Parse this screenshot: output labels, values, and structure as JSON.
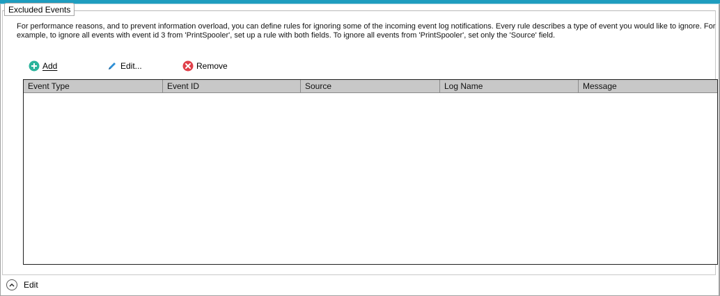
{
  "group": {
    "title": "Excluded Events"
  },
  "description": "For performance reasons, and to prevent information overload, you can define rules for ignoring some of the incoming event log notifications. Every rule describes a type of event you would like to ignore. For example, to ignore all events with event id 3 from 'PrintSpooler', set up a rule with both fields. To ignore all events from 'PrintSpooler', set only the 'Source' field.",
  "toolbar": {
    "add_label": "Add",
    "edit_label": "Edit...",
    "remove_label": "Remove"
  },
  "grid": {
    "columns": [
      "Event Type",
      "Event ID",
      "Source",
      "Log Name",
      "Message"
    ],
    "rows": []
  },
  "footer": {
    "edit_label": "Edit"
  },
  "colors": {
    "accent_bar": "#1e9dbf",
    "add_icon": "#2bb39c",
    "edit_icon": "#2e8fd6",
    "remove_icon": "#e0404a",
    "header_bg": "#c8c8c8"
  },
  "icons": {
    "add": "plus-circle-icon",
    "edit": "pencil-icon",
    "remove": "x-circle-icon",
    "footer": "chevron-up-circle-icon"
  }
}
